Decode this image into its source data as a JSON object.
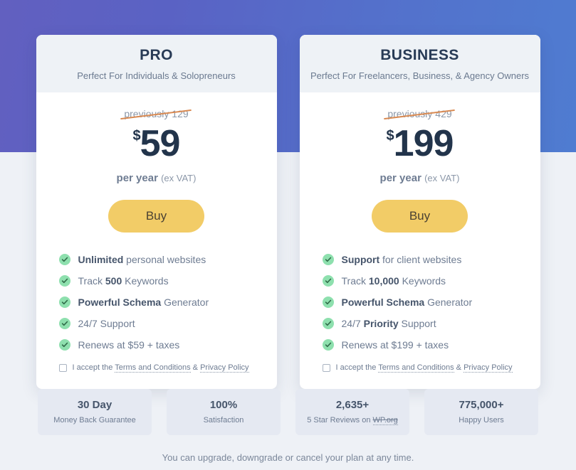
{
  "plans": [
    {
      "id": "pro",
      "name": "PRO",
      "tagline": "Perfect For Individuals & Solopreneurs",
      "previously": "previously 129",
      "currency": "$",
      "amount": "59",
      "period": "per year",
      "vat": "(ex VAT)",
      "buy_label": "Buy",
      "featured": false,
      "features": [
        {
          "strong": "Unlimited",
          "rest": " personal websites",
          "lead": ""
        },
        {
          "strong": "500",
          "rest": " Keywords",
          "lead": "Track "
        },
        {
          "strong": "Powerful Schema",
          "rest": " Generator",
          "lead": ""
        },
        {
          "strong": "",
          "rest": "24/7 Support",
          "lead": ""
        },
        {
          "strong": "",
          "rest": "Renews at $59 + taxes",
          "lead": ""
        }
      ],
      "terms": {
        "prefix": "I accept the ",
        "terms_link": "Terms and Conditions",
        "separator": " & ",
        "privacy_link": "Privacy Policy"
      }
    },
    {
      "id": "business",
      "name": "BUSINESS",
      "tagline": "Perfect For Freelancers, Business, & Agency Owners",
      "previously": "previously 429",
      "currency": "$",
      "amount": "199",
      "period": "per year",
      "vat": "(ex VAT)",
      "buy_label": "Buy",
      "featured": true,
      "features": [
        {
          "strong": "Support",
          "rest": " for client websites",
          "lead": ""
        },
        {
          "strong": "10,000",
          "rest": " Keywords",
          "lead": "Track "
        },
        {
          "strong": "Powerful Schema",
          "rest": " Generator",
          "lead": ""
        },
        {
          "strong": "Priority",
          "rest": " Support",
          "lead": "24/7 "
        },
        {
          "strong": "",
          "rest": "Renews at $199 + taxes",
          "lead": ""
        }
      ],
      "terms": {
        "prefix": "I accept the ",
        "terms_link": "Terms and Conditions",
        "separator": " & ",
        "privacy_link": "Privacy Policy"
      }
    }
  ],
  "stats": [
    {
      "value": "30 Day",
      "label": "Money Back Guarantee",
      "link_text": ""
    },
    {
      "value": "100%",
      "label": "Satisfaction",
      "link_text": ""
    },
    {
      "value": "2,635+",
      "label": "5 Star Reviews on ",
      "link_text": "WP.org"
    },
    {
      "value": "775,000+",
      "label": "Happy Users",
      "link_text": ""
    }
  ],
  "footnote": "You can upgrade, downgrade or cancel your plan at any time.",
  "colors": {
    "gradient_start": "#6260c0",
    "gradient_end": "#4f7cd1",
    "page_bg": "#eef1f6",
    "card_head_bg": "#eef2f6",
    "buy_button": "#f2cc67",
    "check_green": "#8ee0ae",
    "strike_orange": "#d98a52",
    "stat_bg": "#e5e9f2",
    "heading_text": "#283b56",
    "body_text": "#6e7c92"
  }
}
